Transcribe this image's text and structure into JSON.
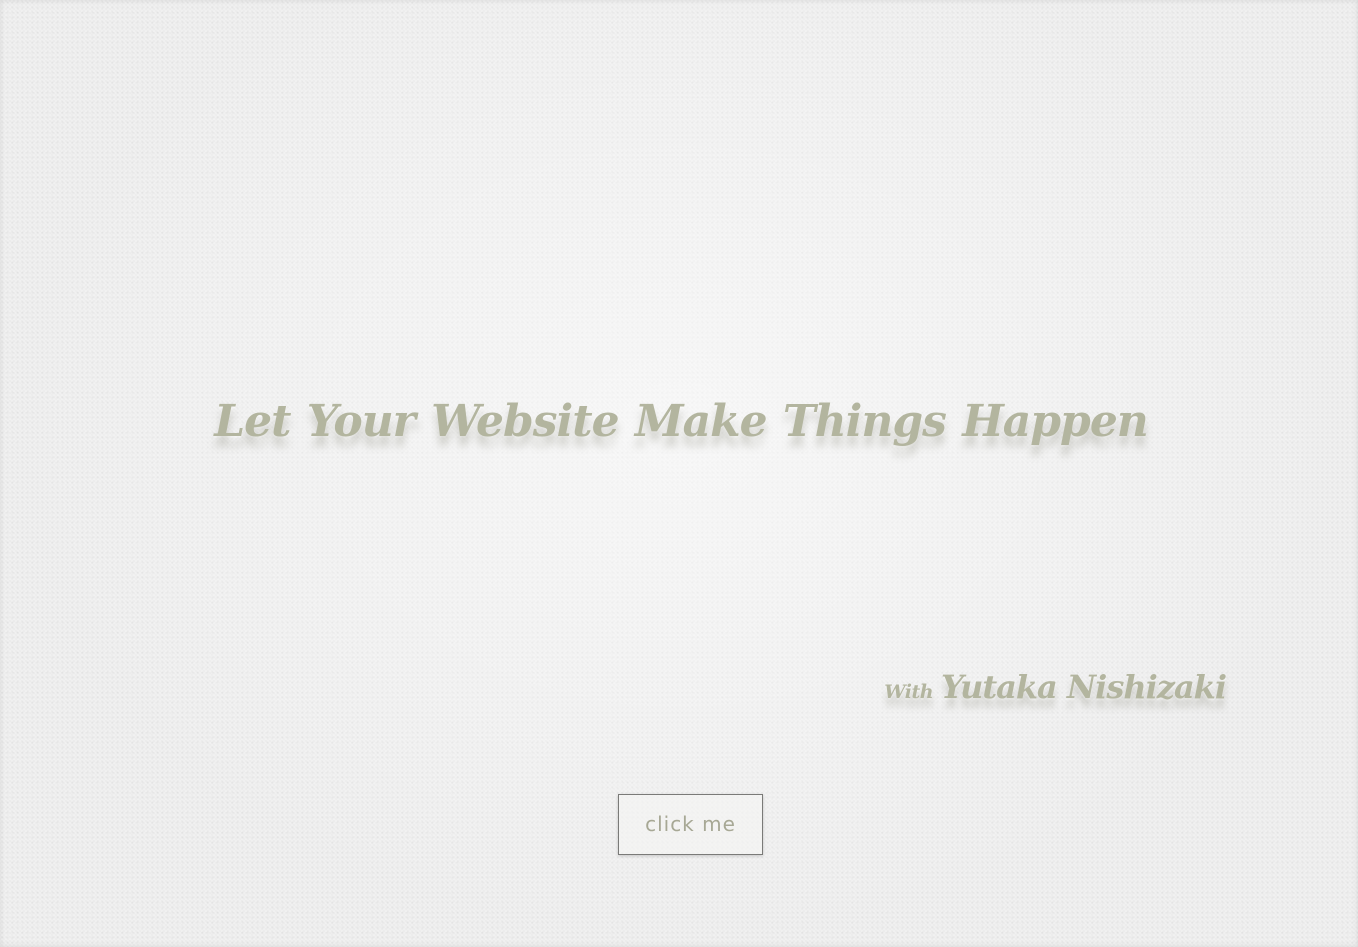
{
  "hero": {
    "headline": "Let Your Website  Make Things Happen",
    "byline_prefix": "With",
    "byline_name": "Yutaka Nishizaki"
  },
  "cta": {
    "label": "click me"
  },
  "colors": {
    "text": "#b3b59f",
    "button_text": "#a7a895",
    "button_border": "#7a7a78",
    "background": "#f1f1f1"
  }
}
